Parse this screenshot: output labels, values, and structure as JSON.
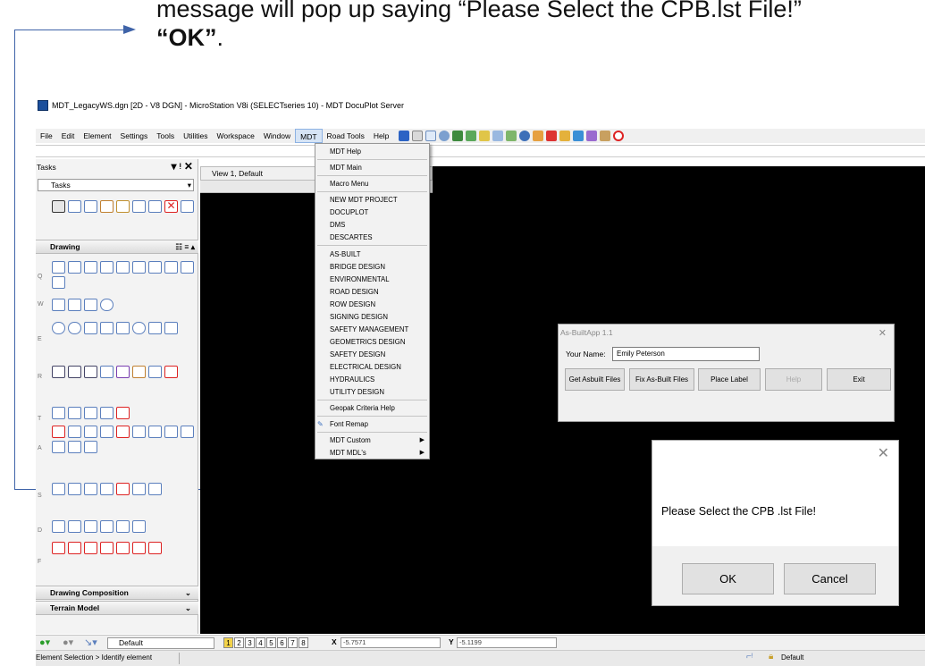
{
  "instructions": {
    "line1": "message will pop up saying “Please Select the CPB.lst File!”",
    "line2": "“OK”",
    "line2_tail": "."
  },
  "window": {
    "title": "MDT_LegacyWS.dgn [2D - V8 DGN] - MicroStation V8i (SELECTseries 10) - MDT DocuPlot Server"
  },
  "menubar": [
    "File",
    "Edit",
    "Element",
    "Settings",
    "Tools",
    "Utilities",
    "Workspace",
    "Window",
    "MDT",
    "Road Tools",
    "Help"
  ],
  "tasks": {
    "title": "Tasks",
    "dropdown": "Tasks",
    "drawing_section": "Drawing",
    "row_letters": [
      "Q",
      "W",
      "E",
      "R",
      "T",
      "A",
      "S",
      "D",
      "F"
    ],
    "drawing_composition": "Drawing Composition",
    "terrain_model": "Terrain Model"
  },
  "view": {
    "tab_title": "View 1, Default"
  },
  "mdt_menu": [
    "MDT Help",
    "MDT Main",
    "Macro Menu",
    "NEW MDT PROJECT",
    "DOCUPLOT",
    "DMS",
    "DESCARTES",
    "AS-BUILT",
    "BRIDGE DESIGN",
    "ENVIRONMENTAL",
    "ROAD DESIGN",
    "ROW DESIGN",
    "SIGNING DESIGN",
    "SAFETY MANAGEMENT",
    "GEOMETRICS DESIGN",
    "SAFETY DESIGN",
    "ELECTRICAL DESIGN",
    "HYDRAULICS",
    "UTILITY DESIGN",
    "Geopak Criteria Help",
    "Font Remap",
    "MDT Custom",
    "MDT MDL's"
  ],
  "asbuilt_app": {
    "title": "As-BuiltApp 1.1",
    "name_label": "Your Name:",
    "name_value": "Emily Peterson",
    "buttons": [
      "Get Asbuilt Files",
      "Fix As-Built Files",
      "Place Label",
      "Help",
      "Exit"
    ]
  },
  "message_box": {
    "text": "Please Select the CPB .lst File!",
    "ok": "OK",
    "cancel": "Cancel"
  },
  "bottom_bar": {
    "level": "Default",
    "views": [
      "1",
      "2",
      "3",
      "4",
      "5",
      "6",
      "7",
      "8"
    ],
    "x_label": "X",
    "x_value": "-5.7571",
    "y_label": "Y",
    "y_value": "-5.1199"
  },
  "status_bar": {
    "prompt": "Element Selection > Identify element",
    "active_level": "Default"
  },
  "colors": {
    "accent_arrow": "#3f63a8",
    "view_background": "#000000",
    "menu_highlight": "#d6e4f5"
  }
}
